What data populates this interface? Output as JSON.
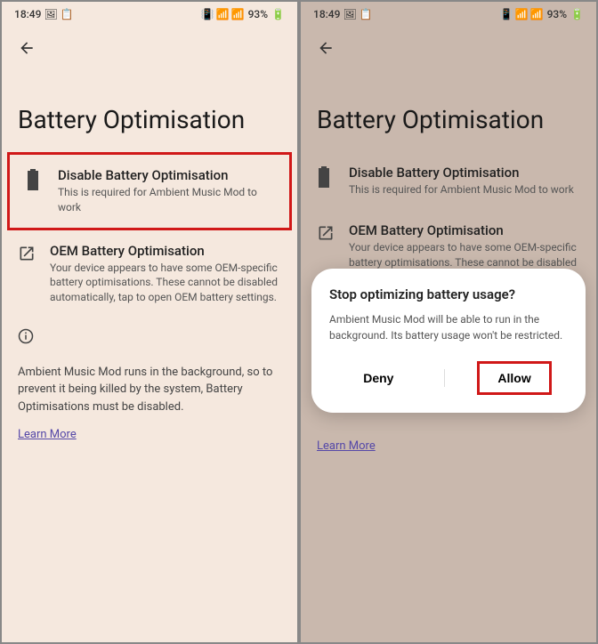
{
  "status": {
    "time": "18:49",
    "battery": "93%"
  },
  "page": {
    "title": "Battery Optimisation"
  },
  "options": {
    "disable": {
      "title": "Disable Battery Optimisation",
      "desc": "This is required for Ambient Music Mod to work"
    },
    "oem": {
      "title": "OEM Battery Optimisation",
      "desc": "Your device appears to have some OEM-specific battery optimisations. These cannot be disabled automatically, tap to open OEM battery settings."
    }
  },
  "info": {
    "text": "Ambient Music Mod runs in the background, so to prevent it being killed by the system, Battery Optimisations must be disabled.",
    "learn_more": "Learn More"
  },
  "dialog": {
    "title": "Stop optimizing battery usage?",
    "desc": "Ambient Music Mod will be able to run in the background. Its battery usage won't be restricted.",
    "deny": "Deny",
    "allow": "Allow"
  }
}
